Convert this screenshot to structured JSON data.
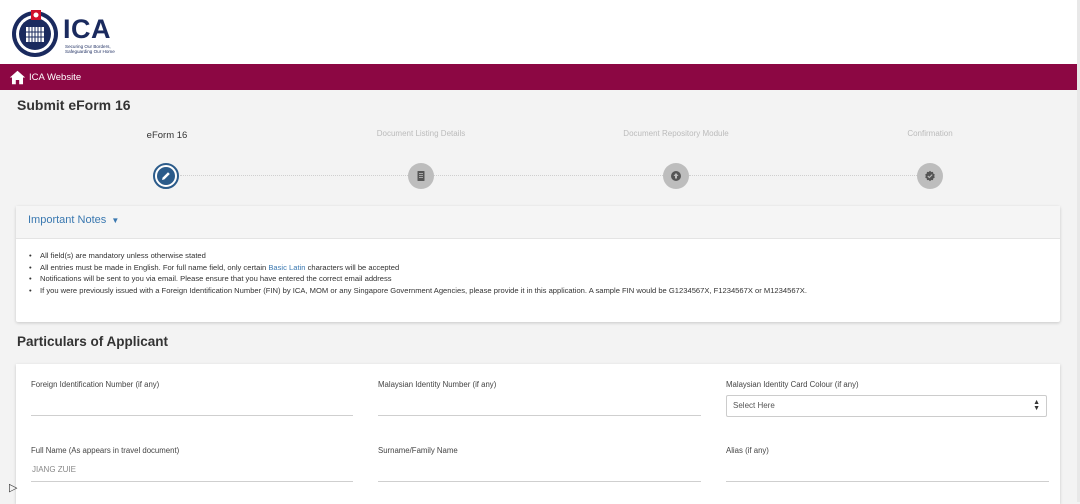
{
  "header": {
    "logo_text": "ICA",
    "logo_tagline_1": "Securing Our Borders,",
    "logo_tagline_2": "Safeguarding Our Home"
  },
  "navbar": {
    "home_label": "ICA Website",
    "color": "#8c0743"
  },
  "page": {
    "title": "Submit eForm 16"
  },
  "stepper": {
    "steps": [
      {
        "label": "eForm 16",
        "icon": "pencil-icon",
        "active": true
      },
      {
        "label": "Document Listing Details",
        "icon": "document-list-icon",
        "active": false
      },
      {
        "label": "Document Repository Module",
        "icon": "upload-icon",
        "active": false
      },
      {
        "label": "Confirmation",
        "icon": "check-badge-icon",
        "active": false
      }
    ]
  },
  "notes": {
    "title": "Important Notes",
    "items": [
      "All field(s) are mandatory unless otherwise stated",
      "All entries must be made in English. For full name field, only certain ",
      "Notifications will be sent to you via email. Please ensure that you have entered the correct email address",
      "If you were previously issued with a Foreign Identification Number (FIN) by ICA, MOM or any Singapore Government Agencies, please provide it in this application. A sample FIN would be G1234567X, F1234567X or M1234567X."
    ],
    "link_text": "Basic Latin",
    "item2_suffix": " characters will be accepted"
  },
  "applicant": {
    "section_title": "Particulars of Applicant",
    "fin_label": "Foreign Identification Number (if any)",
    "fin_value": "",
    "my_id_label": "Malaysian Identity Number (if any)",
    "my_id_value": "",
    "id_colour_label": "Malaysian Identity Card Colour (if any)",
    "id_colour_selected": "Select Here",
    "full_name_label": "Full Name (As appears in travel document)",
    "full_name_value": "JIANG ZUIE",
    "surname_label": "Surname/Family Name",
    "surname_value": "",
    "alias_label": "Alias (if any)",
    "alias_value": ""
  }
}
